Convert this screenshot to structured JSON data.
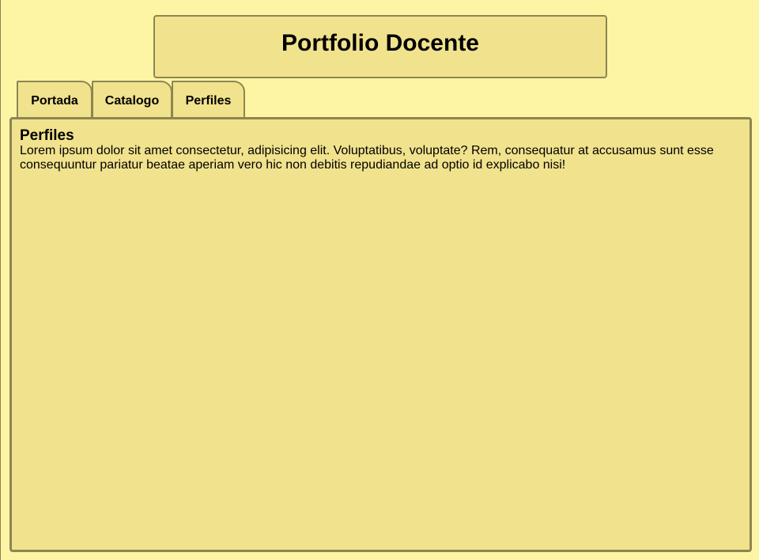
{
  "header": {
    "title": "Portfolio Docente"
  },
  "tabs": [
    {
      "label": "Portada"
    },
    {
      "label": "Catalogo"
    },
    {
      "label": "Perfiles"
    }
  ],
  "content": {
    "heading": "Perfiles",
    "body": "Lorem ipsum dolor sit amet consectetur, adipisicing elit. Voluptatibus, voluptate? Rem, consequatur at accusamus sunt esse consequuntur pariatur beatae aperiam vero hic non debitis repudiandae ad optio id explicabo nisi!"
  },
  "colors": {
    "page_background": "#fdf5a4",
    "panel_background": "#f1e28d",
    "border": "#8d8552"
  }
}
